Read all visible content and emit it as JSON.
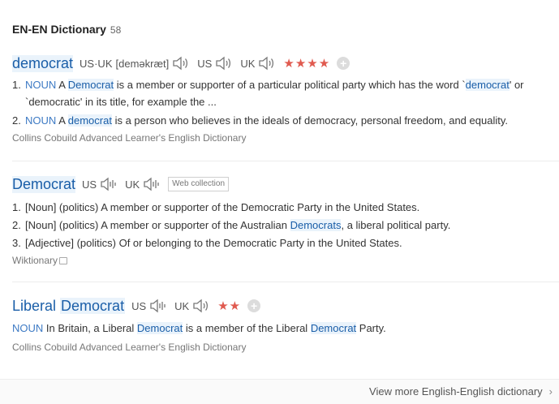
{
  "header": {
    "title": "EN-EN Dictionary",
    "count": "58"
  },
  "entries": [
    {
      "headword": "democrat",
      "pron_usuk_label": "US·UK",
      "pron_ipa": "[deməkræt]",
      "us_label": "US",
      "uk_label": "UK",
      "stars": "★★★★",
      "senses": [
        {
          "num": "1.",
          "pos": "NOUN",
          "pre": "A ",
          "hl1": "Democrat",
          "mid": " is a member or supporter of a particular political party which has the word `",
          "hl2": "democrat",
          "post": "' or `democratic' in its title, for example the ..."
        },
        {
          "num": "2.",
          "pos": "NOUN",
          "pre": "A ",
          "hl1": "democrat",
          "post": " is a person who believes in the ideals of democracy, personal freedom, and equality."
        }
      ],
      "source": "Collins Cobuild Advanced Learner's English Dictionary"
    },
    {
      "headword": "Democrat",
      "us_label": "US",
      "uk_label": "UK",
      "tag": "Web collection",
      "senses": [
        {
          "num": "1.",
          "text": "[Noun] (politics) A member or supporter of the Democratic Party in the United States."
        },
        {
          "num": "2.",
          "pre": "[Noun] (politics) A member or supporter of the Australian ",
          "hl": "Democrats",
          "post": ", a liberal political party."
        },
        {
          "num": "3.",
          "text": "[Adjective] (politics) Of or belonging to the Democratic Party in the United States."
        }
      ],
      "source": "Wiktionary"
    },
    {
      "headword_pre": "Liberal ",
      "headword_hl": "Democrat",
      "us_label": "US",
      "uk_label": "UK",
      "stars": "★★",
      "sense": {
        "pos": "NOUN",
        "pre": "In Britain, a Liberal ",
        "hl1": "Democrat",
        "mid": " is a member of the Liberal ",
        "hl2": "Democrat",
        "post": " Party."
      },
      "source": "Collins Cobuild Advanced Learner's English Dictionary"
    }
  ],
  "footer": {
    "more_label": "View more English-English dictionary",
    "chevron": "›"
  },
  "icons": {
    "speaker": "speaker-icon",
    "speaker_alt": "speaker-bars-icon",
    "add": "plus-icon",
    "external": "external-link-icon"
  },
  "colors": {
    "headword": "#1a5ea8",
    "highlight_bg": "#eaf3fb",
    "stars": "#e05a4f",
    "pos": "#3d7ac4"
  }
}
